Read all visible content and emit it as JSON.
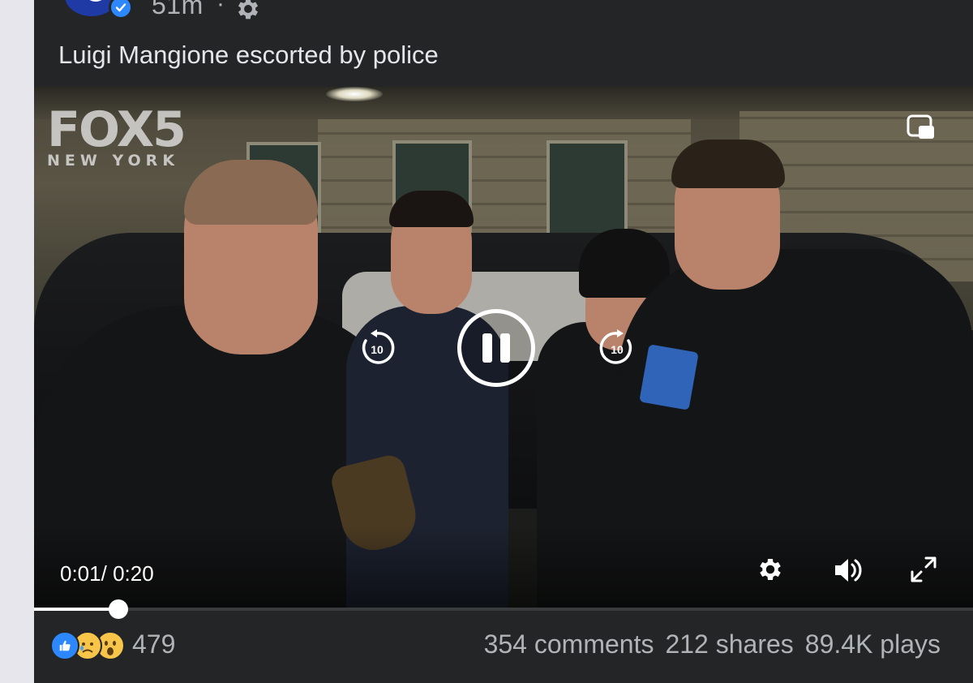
{
  "post": {
    "time": "51m",
    "separator": "·",
    "text": "Luigi Mangione escorted by police",
    "privacy_icon": "gear-icon",
    "verified_icon": "verified-badge-icon"
  },
  "video": {
    "watermark_main": "FOX5",
    "watermark_sub": "NEW YORK",
    "rewind_label": "10",
    "forward_label": "10",
    "current_time": "0:01",
    "time_separator": "/",
    "duration": "0:20",
    "progress_fraction": 0.05,
    "icons": {
      "pip": "picture-in-picture-icon",
      "rewind": "rewind-10-icon",
      "pause": "pause-icon",
      "forward": "forward-10-icon",
      "settings": "settings-gear-icon",
      "volume": "volume-icon",
      "fullscreen": "fullscreen-icon"
    }
  },
  "footer": {
    "reaction_icons": [
      "like-icon",
      "sad-icon",
      "wow-icon"
    ],
    "reaction_count": "479",
    "comments": "354 comments",
    "shares": "212 shares",
    "plays": "89.4K plays"
  },
  "colors": {
    "card_bg": "#242526",
    "text_primary": "#e4e6eb",
    "text_secondary": "#b0b3b8",
    "accent_blue": "#2d88ff"
  }
}
